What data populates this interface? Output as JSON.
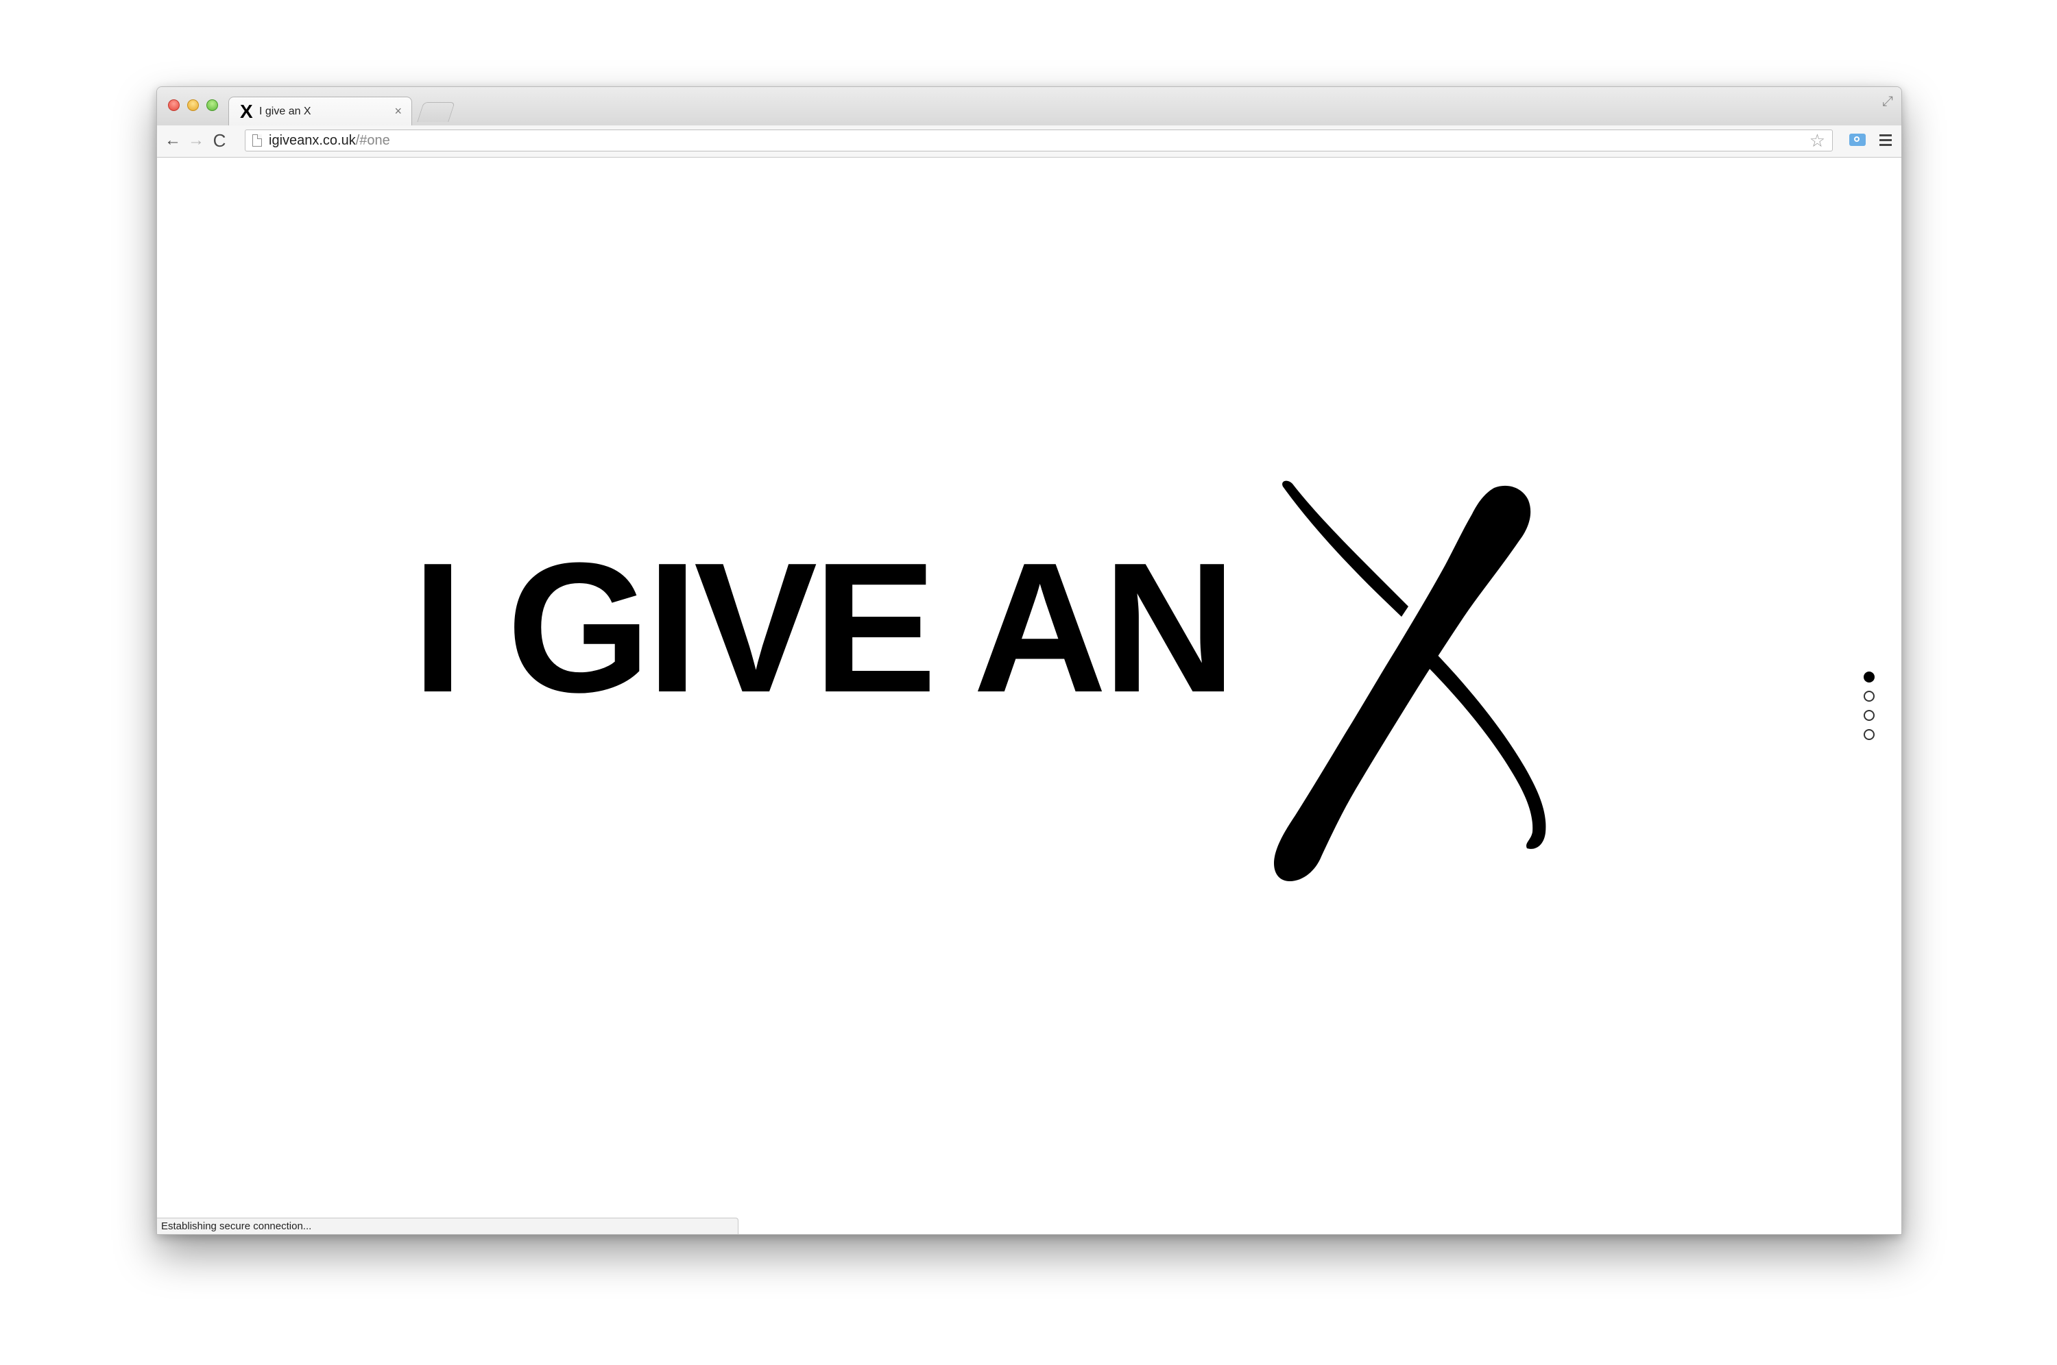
{
  "browser": {
    "tab_title": "I give an X",
    "tab_favicon": "X",
    "tab_close": "×",
    "url_host": "igiveanx.co.uk",
    "url_path": "/#one",
    "back_icon": "←",
    "forward_icon": "→",
    "reload_icon": "C",
    "star_icon": "☆",
    "fullscreen_icon": "⤢",
    "status_text": "Establishing secure connection..."
  },
  "page": {
    "headline": "I GIVE AN",
    "brand_mark": "X",
    "section_dots": [
      {
        "section": "one",
        "active": true
      },
      {
        "section": "two",
        "active": false
      },
      {
        "section": "three",
        "active": false
      },
      {
        "section": "four",
        "active": false
      }
    ]
  }
}
